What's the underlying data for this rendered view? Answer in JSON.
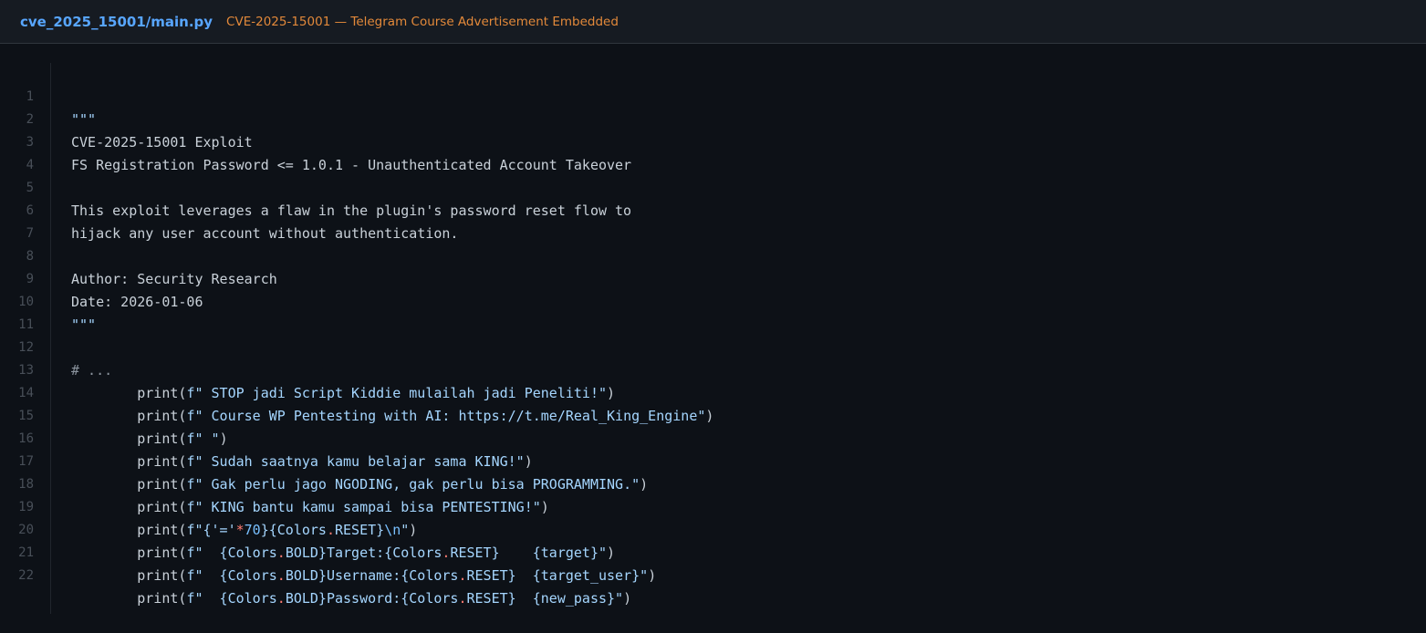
{
  "header": {
    "file_path": "cve_2025_15001/main.py",
    "note": "CVE-2025-15001 — Telegram Course Advertisement Embedded"
  },
  "colors": {
    "background": "#0d1117",
    "header_bg": "#161b22",
    "path_blue": "#58a6ff",
    "note_orange": "#e3893a",
    "string_blue": "#a5d6ff",
    "operator_red": "#ff7b72"
  },
  "code": {
    "line_numbers": [
      "1",
      "2",
      "3",
      "4",
      "5",
      "6",
      "7",
      "8",
      "9",
      "10",
      "11",
      "12",
      "13",
      "14",
      "15",
      "16",
      "17",
      "18",
      "19",
      "20",
      "21",
      "22"
    ],
    "docstring": {
      "l1": "\"\"\"",
      "l2": "CVE-2025-15001 Exploit",
      "l3": "FS Registration Password <= 1.0.1 - Unauthenticated Account Takeover",
      "l5": "This exploit leverages a flaw in the plugin's password reset flow to",
      "l6": "hijack any user account without authentication.",
      "l8": "Author: Security Research",
      "l9": "Date: 2026-01-06",
      "l10": "\"\"\""
    },
    "comment_l12": "# ...",
    "print_open": "print(",
    "print_close": ")",
    "indent": "        ",
    "str_prefix": "f\"",
    "str_quote_end": "\"",
    "prints": {
      "l13": " STOP jadi Script Kiddie mulailah jadi Peneliti!",
      "l14": " Course WP Pentesting with AI: https://t.me/Real_King_Engine",
      "l15": " ",
      "l16": " Sudah saatnya kamu belajar sama KING!",
      "l17": " Gak perlu jago NGODING, gak perlu bisa PROGRAMMING.",
      "l18": " KING bantu kamu sampai bisa PENTESTING!"
    },
    "l19": {
      "brace_open": "{'='",
      "star": "*",
      "num": "70",
      "mid": "}{Colors",
      "dot": ".",
      "reset": "RESET}",
      "esc": "\\n",
      "end": "\""
    },
    "l20": {
      "a": "  {Colors",
      "dot1": ".",
      "b": "BOLD}Target:{Colors",
      "dot2": ".",
      "c": "RESET}    {target}\""
    },
    "l21": {
      "a": "  {Colors",
      "dot1": ".",
      "b": "BOLD}Username:{Colors",
      "dot2": ".",
      "c": "RESET}  {target_user}\""
    },
    "l22": {
      "a": "  {Colors",
      "dot1": ".",
      "b": "BOLD}Password:{Colors",
      "dot2": ".",
      "c": "RESET}  {new_pass}\""
    }
  }
}
